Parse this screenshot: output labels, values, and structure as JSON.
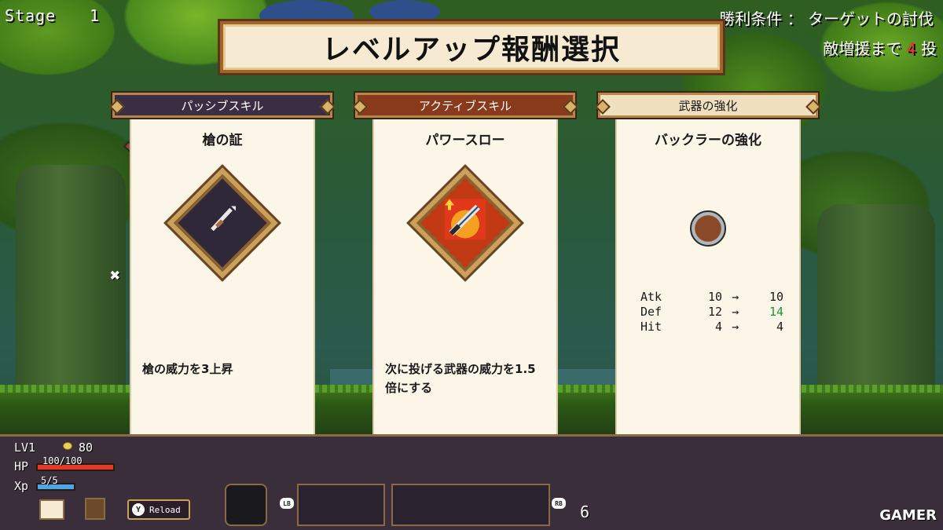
{
  "hud_top": {
    "stage_label": "Stage",
    "stage_number": "1",
    "win_condition": "勝利条件 ： ターゲットの討伐",
    "reinforcement_prefix": "敵増援まで",
    "reinforcement_count": "4",
    "reinforcement_suffix": "投"
  },
  "title": "レベルアップ報酬選択",
  "cards": [
    {
      "category": "パッシブスキル",
      "name": "槍の証",
      "icon": "spear-emblem-icon",
      "description": "槍の威力を3上昇"
    },
    {
      "category": "アクティブスキル",
      "name": "パワースロー",
      "icon": "flaming-sword-icon",
      "description": "次に投げる武器の威力を1.5倍にする"
    },
    {
      "category": "武器の強化",
      "name": "バックラーの強化",
      "icon": "buckler-icon",
      "stats": [
        {
          "label": "Atk",
          "before": "10",
          "arrow": "→",
          "after": "10"
        },
        {
          "label": "Def",
          "before": "12",
          "arrow": "→",
          "after": "14"
        },
        {
          "label": "Hit",
          "before": "4",
          "arrow": "→",
          "after": "4"
        }
      ]
    }
  ],
  "close_symbol": "✖",
  "hud_bottom": {
    "level": "LV1",
    "gold": "80",
    "hp_label": "HP",
    "hp_value": "100/100",
    "hp_fraction": 1.0,
    "xp_label": "Xp",
    "xp_value": "5/5",
    "xp_fraction": 1.0,
    "reload_button": "Y",
    "reload_label": "Reload",
    "lb_label": "LB",
    "rb_label": "RB",
    "weapon_count": "6"
  },
  "watermark": "GAMER",
  "colors": {
    "passive_tab": "#3b2e44",
    "active_tab": "#8a3a1c",
    "upgrade_tab": "#f1e0bf",
    "stat_up": "#1e9a2c",
    "reinforce_num": "#ff2a2a"
  }
}
